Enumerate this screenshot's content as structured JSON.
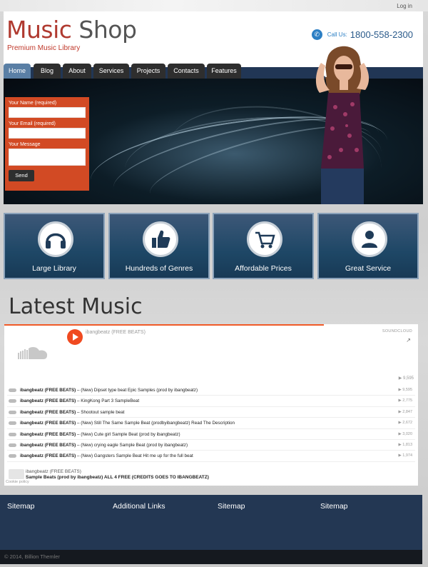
{
  "topbar": {
    "login": "Log in"
  },
  "header": {
    "logo_part1": "Music",
    "logo_part2": "Shop",
    "tagline": "Premium Music Library",
    "phone_label": "Call Us:",
    "phone_number": "1800-558-2300"
  },
  "nav": {
    "items": [
      {
        "label": "Home",
        "active": true
      },
      {
        "label": "Blog"
      },
      {
        "label": "About"
      },
      {
        "label": "Services"
      },
      {
        "label": "Projects"
      },
      {
        "label": "Contacts"
      },
      {
        "label": "Features"
      }
    ]
  },
  "contact_form": {
    "name_label": "Your Name (required)",
    "email_label": "Your Email (required)",
    "message_label": "Your Message",
    "send": "Send"
  },
  "features": [
    {
      "label": "Large Library",
      "icon": "headphones-icon"
    },
    {
      "label": "Hundreds of Genres",
      "icon": "thumbs-up-icon"
    },
    {
      "label": "Affordable Prices",
      "icon": "shopping-cart-icon"
    },
    {
      "label": "Great Service",
      "icon": "user-icon"
    }
  ],
  "latest_music": {
    "title": "Latest Music",
    "player": {
      "artist": "ibangbeatz (FREE BEATS)",
      "brand": "SOUNDCLOUD",
      "plays": "9,595",
      "tracks": [
        {
          "artist": "ibangbeatz (FREE BEATS)",
          "title": " – (New) Dipset type beat Epic Samples (prod by ibangbeatz)",
          "plays": "9,595"
        },
        {
          "artist": "ibangbeatz (FREE BEATS)",
          "title": " – KingKong Part 3 SampleBeat",
          "plays": "2,775"
        },
        {
          "artist": "ibangbeatz (FREE BEATS)",
          "title": " – Shootout sample beat",
          "plays": "2,847"
        },
        {
          "artist": "ibangbeatz (FREE BEATS)",
          "title": " – (New) Still The Same Sample Beat (prodbyibangbeatz) Read The Description",
          "plays": "2,672"
        },
        {
          "artist": "ibangbeatz (FREE BEATS)",
          "title": " – (New) Cute girl Sample Beat (prod by ibangbeatz)",
          "plays": "3,020"
        },
        {
          "artist": "ibangbeatz (FREE BEATS)",
          "title": " – (New) crying eagle Sample Beat (prod by ibangbeatz)",
          "plays": "1,813"
        },
        {
          "artist": "ibangbeatz (FREE BEATS)",
          "title": " – (New) Gangsters Sample Beat Hit me up for the full beat",
          "plays": "1,974"
        }
      ],
      "now_playing_artist": "ibangbeatz (FREE BEATS)",
      "now_playing_title": "Sample Beats (prod by ibangbeatz) ALL 4 FREE (CREDITS GOES TO IBANGBEATZ)",
      "cookie": "Cookie policy"
    }
  },
  "footer": {
    "columns": [
      "Sitemap",
      "Additional Links",
      "Sitemap",
      "Sitemap"
    ],
    "copyright": "© 2014, Billion Themler"
  },
  "colors": {
    "brand_red": "#b03a30",
    "accent_orange": "#d24a24",
    "nav_blue": "#213655",
    "footer_blue": "#233753"
  }
}
